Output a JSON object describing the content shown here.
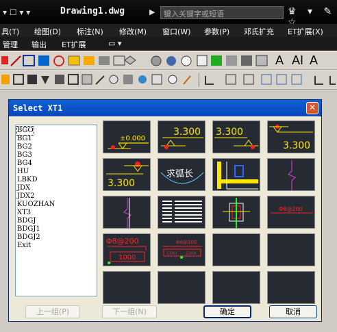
{
  "titlebar": {
    "quick_access": "▾  ☐ ▾  ▾",
    "title": "Drawing1.dwg",
    "search_placeholder": "键入关键字或短语",
    "icons": "♛ ▾ ✎ ☆"
  },
  "menubar": {
    "items": [
      "具(T)",
      "绘图(D)",
      "标注(N)",
      "修改(M)",
      "窗口(W)",
      "参数(P)",
      "邓氏扩充",
      "ET扩展(X)"
    ]
  },
  "ribbon": {
    "items": [
      "管理",
      "输出",
      "ET扩展",
      "▭ ▾"
    ]
  },
  "toolbar_text": {
    "a1": "A",
    "a2": "AI",
    "a3": "A"
  },
  "dialog": {
    "title": "Select XT1",
    "close_symbol": "✕",
    "list_items": [
      "BGO",
      "BG1",
      "BG2",
      "BG3",
      "BG4",
      "HU",
      "LBKD",
      "JDX",
      "JDX2",
      "KUOZHAN",
      "XT3",
      "BDGJ",
      "BDGJ1",
      "BDGJ2",
      "Exit"
    ],
    "selected_item": "BGO",
    "buttons": {
      "prev": "上一组(P)",
      "next": "下一组(N)",
      "ok": "确定",
      "cancel": "取消"
    },
    "thumbnails": {
      "t1": "±0.000",
      "t2": "3.300",
      "t3": "3.300",
      "t4": "3.300",
      "t5": "3.300",
      "t6": "求弧长",
      "t10": "Φ8@200",
      "t13": "Φ8@200",
      "t13b": "1000",
      "t14": "Φ8@100",
      "t14b": "1200",
      "t14c": "1200"
    }
  },
  "colors": {
    "dialog_title_bar": "#0a45b8",
    "thumb_bg": "#262b33",
    "accent_red": "#ff2020",
    "accent_yellow": "#ffe600"
  }
}
